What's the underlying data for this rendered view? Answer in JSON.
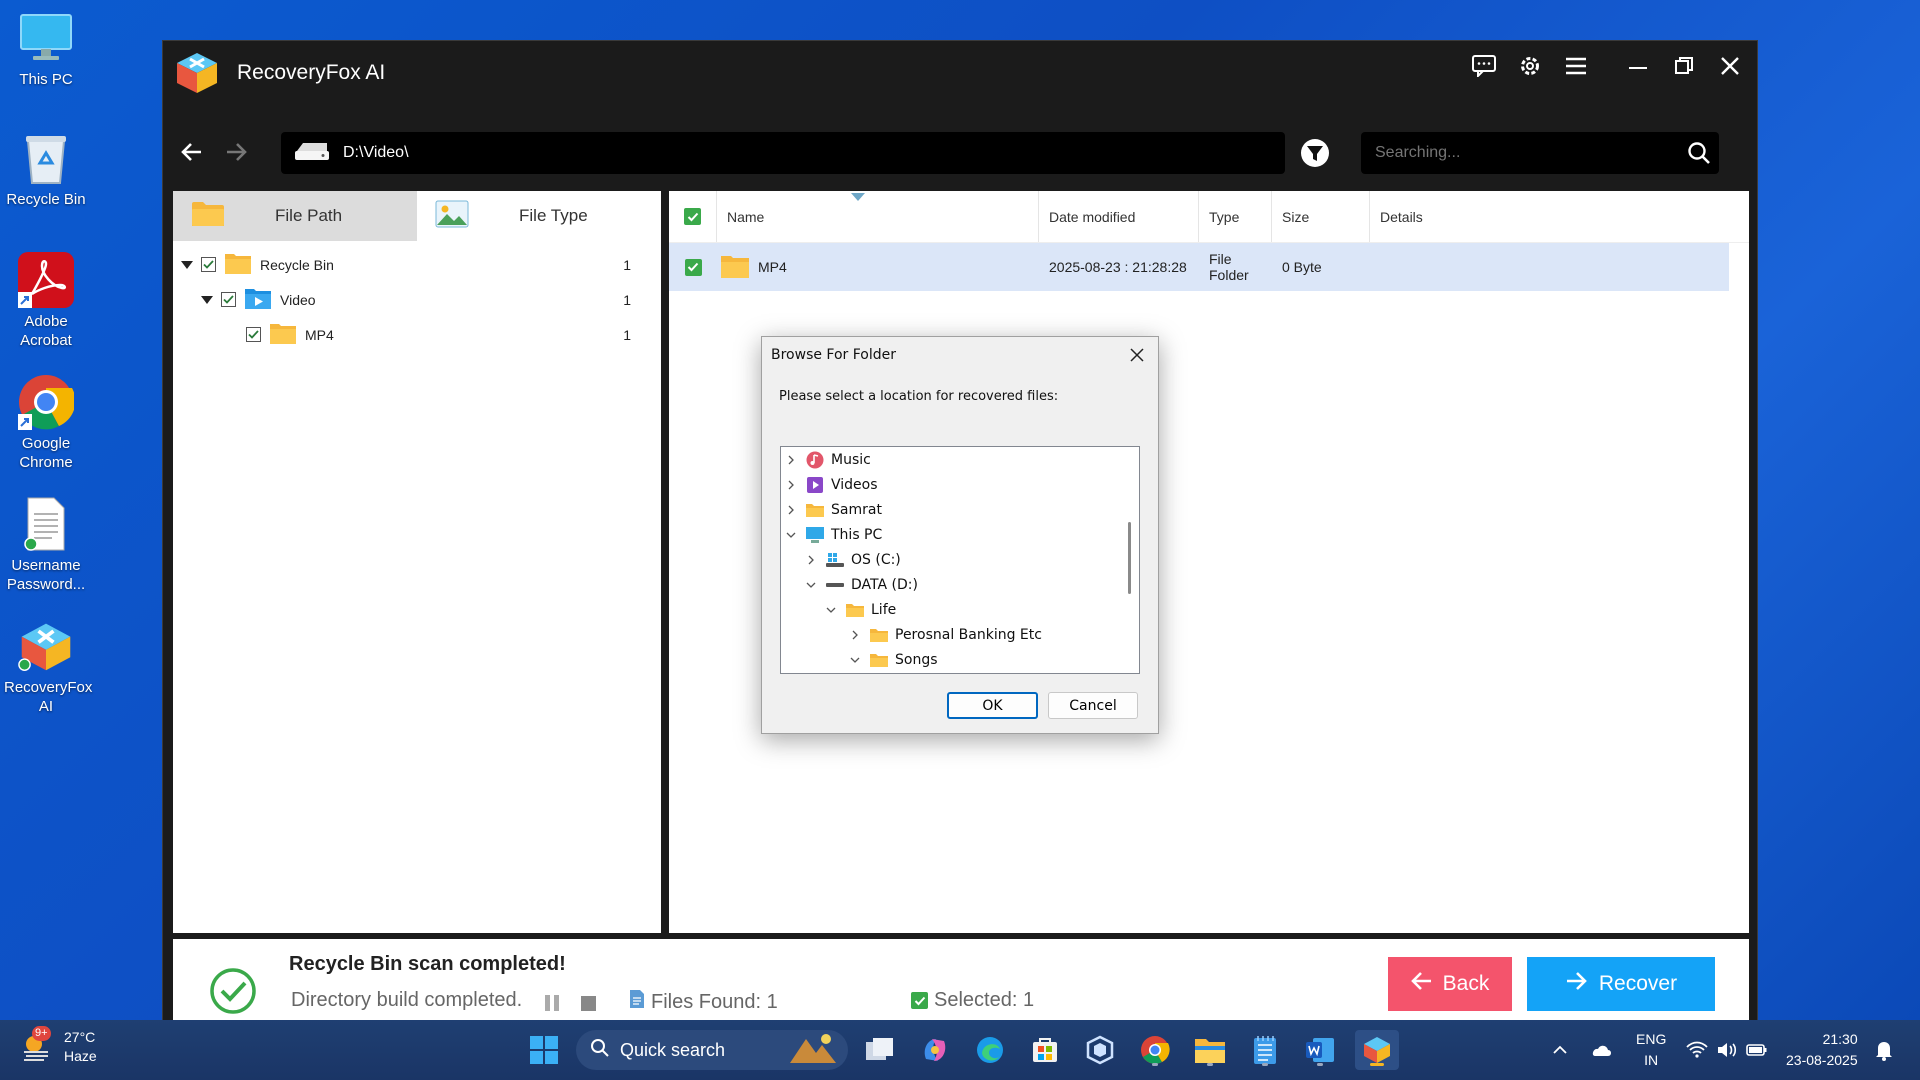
{
  "desktop": {
    "icons": [
      {
        "label": "This PC"
      },
      {
        "label": "Recycle Bin"
      },
      {
        "label": "Adobe Acrobat"
      },
      {
        "label": "Google Chrome"
      },
      {
        "label": "Username Password..."
      },
      {
        "label": "RecoveryFox AI"
      }
    ]
  },
  "app": {
    "title": "RecoveryFox AI",
    "path": "D:\\Video\\",
    "search_placeholder": "Searching...",
    "tabs": [
      {
        "label": "File Path"
      },
      {
        "label": "File Type"
      }
    ],
    "tree": [
      {
        "label": "Recycle Bin",
        "count": "1"
      },
      {
        "label": "Video",
        "count": "1"
      },
      {
        "label": "MP4",
        "count": "1"
      }
    ],
    "table": {
      "columns": [
        "Name",
        "Date modified",
        "Type",
        "Size",
        "Details"
      ],
      "rows": [
        {
          "name": "MP4",
          "date": "2025-08-23 : 21:28:28",
          "type": "File Folder",
          "size": "0 Byte",
          "details": ""
        }
      ]
    },
    "status": {
      "title": "Recycle Bin scan completed!",
      "subtitle": "Directory build completed.",
      "files_found": "Files Found: 1",
      "selected": "Selected: 1"
    },
    "buttons": {
      "back": "Back",
      "recover": "Recover"
    }
  },
  "dialog": {
    "title": "Browse For Folder",
    "prompt": "Please select a location for recovered files:",
    "items": [
      {
        "label": "Music"
      },
      {
        "label": "Videos"
      },
      {
        "label": "Samrat"
      },
      {
        "label": "This PC"
      },
      {
        "label": "OS (C:)"
      },
      {
        "label": "DATA (D:)"
      },
      {
        "label": "Life"
      },
      {
        "label": "Perosnal Banking Etc"
      },
      {
        "label": "Songs"
      }
    ],
    "ok": "OK",
    "cancel": "Cancel"
  },
  "taskbar": {
    "weather_temp": "27°C",
    "weather_desc": "Haze",
    "weather_badge": "9+",
    "search_label": "Quick search",
    "lang_top": "ENG",
    "lang_bottom": "IN",
    "time": "21:30",
    "date": "23-08-2025"
  },
  "colors": {
    "accent_recover": "#14a3f7",
    "accent_back": "#f4546c",
    "status_green": "#3aa94a",
    "selection_row": "#dbe6f8"
  }
}
